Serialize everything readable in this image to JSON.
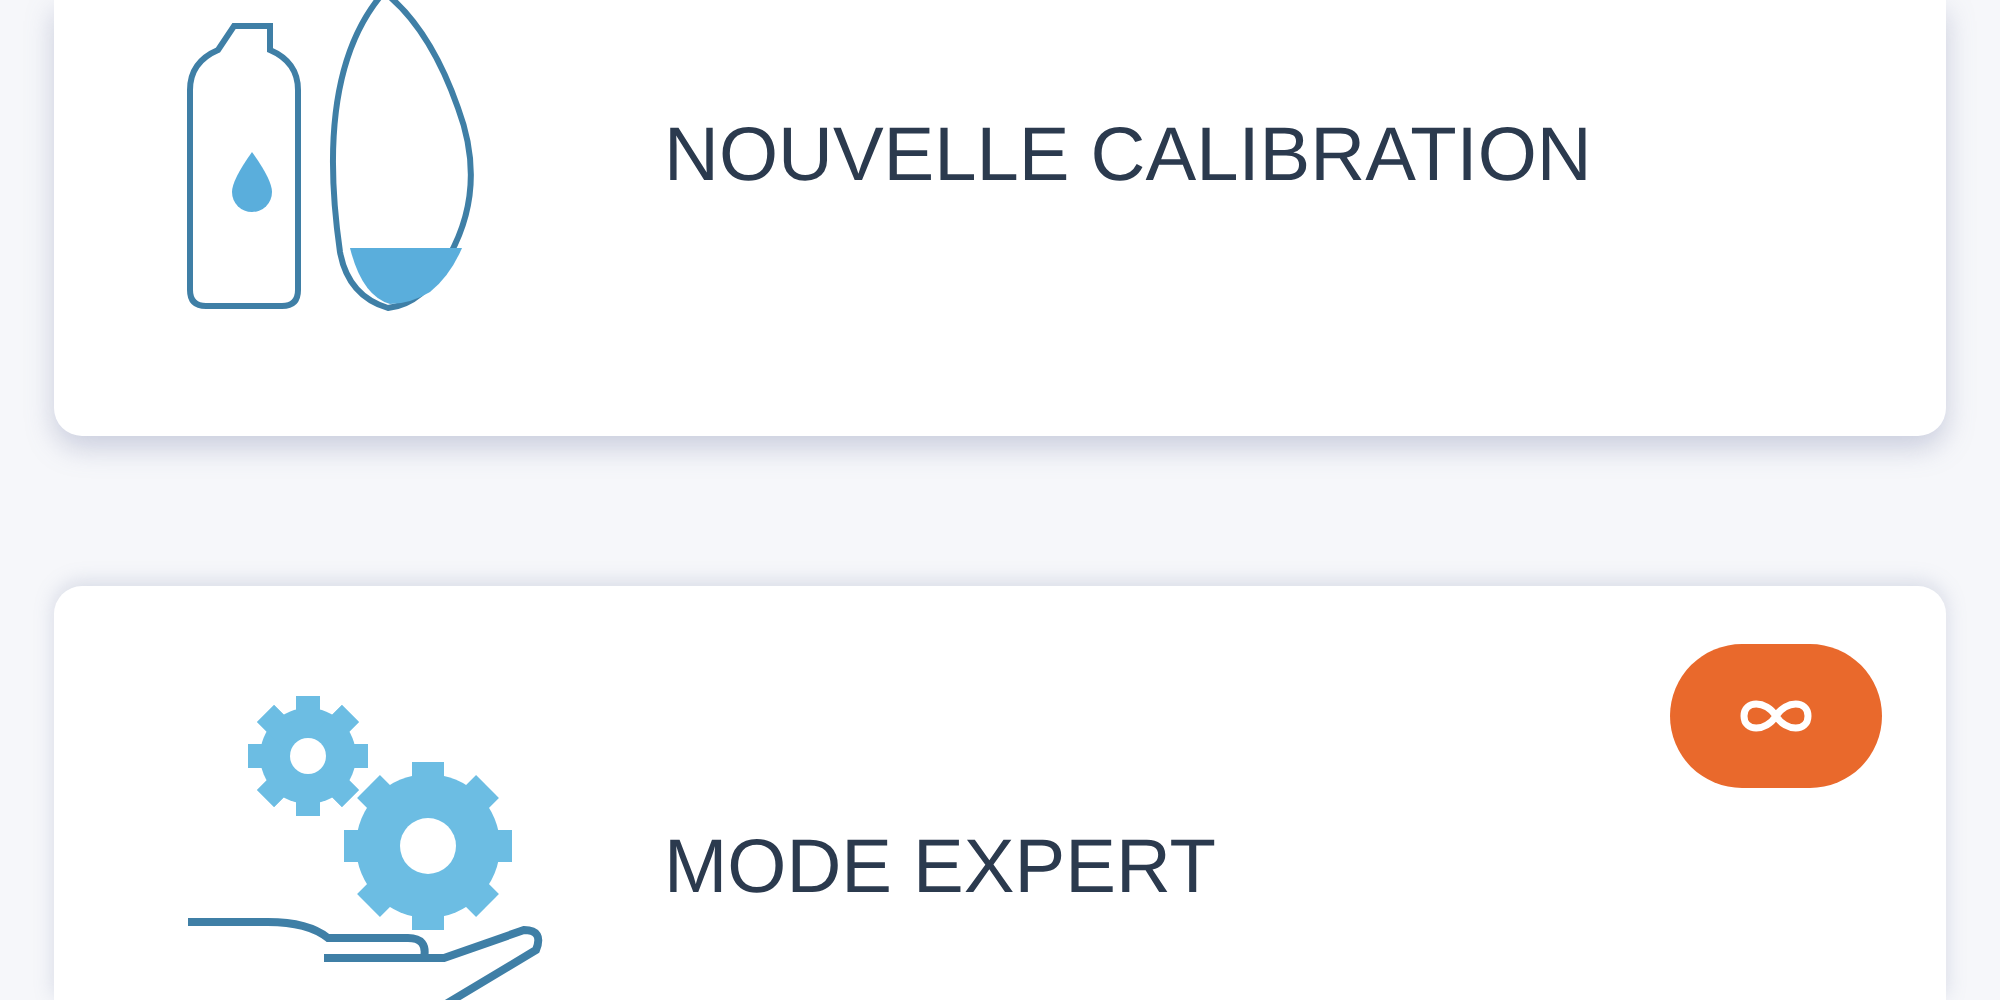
{
  "cards": [
    {
      "label": "NOUVELLE CALIBRATION",
      "kind": "calibration",
      "badge": false
    },
    {
      "label": "MODE EXPERT",
      "kind": "expert",
      "badge": true
    }
  ]
}
